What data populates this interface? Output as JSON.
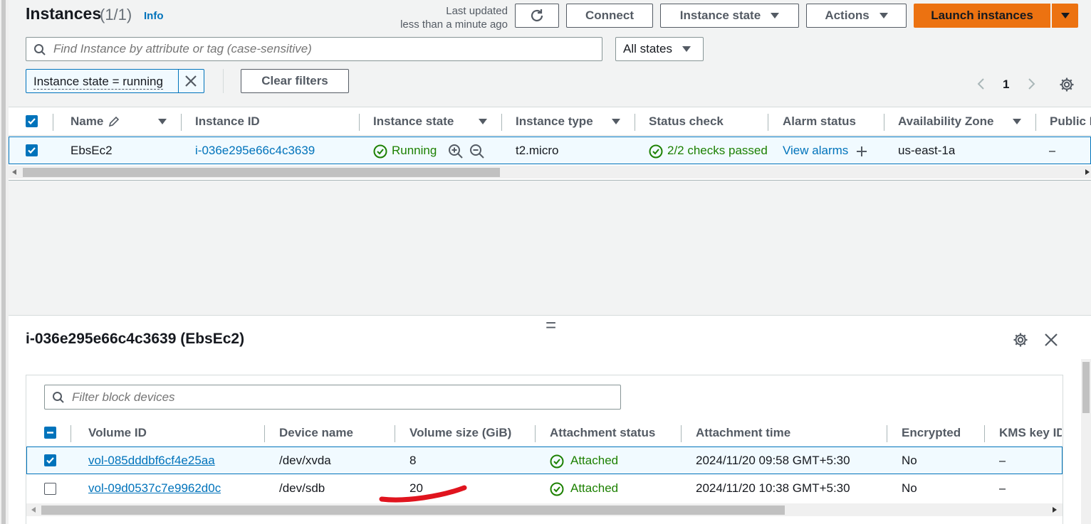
{
  "header": {
    "title": "Instances",
    "count": "(1/1)",
    "info": "Info",
    "last_updated_line1": "Last updated",
    "last_updated_line2": "less than a minute ago",
    "connect_label": "Connect",
    "instance_state_label": "Instance state",
    "actions_label": "Actions",
    "launch_label": "Launch instances"
  },
  "search": {
    "placeholder": "Find Instance by attribute or tag (case-sensitive)",
    "states_filter": "All states"
  },
  "filters": {
    "chip": "Instance state = running",
    "clear_label": "Clear filters",
    "page_number": "1"
  },
  "instances_table": {
    "columns": [
      "Name",
      "Instance ID",
      "Instance state",
      "Instance type",
      "Status check",
      "Alarm status",
      "Availability Zone",
      "Public I"
    ],
    "row": {
      "name": "EbsEc2",
      "instance_id": "i-036e295e66c4c3639",
      "state": "Running",
      "type": "t2.micro",
      "status_check": "2/2 checks passed",
      "alarm": "View alarms",
      "az": "us-east-1a",
      "public": "–"
    }
  },
  "details": {
    "splitter": "=",
    "title": "i-036e295e66c4c3639 (EbsEc2)",
    "filter_placeholder": "Filter block devices",
    "columns": [
      "Volume ID",
      "Device name",
      "Volume size (GiB)",
      "Attachment status",
      "Attachment time",
      "Encrypted",
      "KMS key ID"
    ],
    "rows": [
      {
        "volume_id": "vol-085dddbf6cf4e25aa",
        "device": "/dev/xvda",
        "size": "8",
        "status": "Attached",
        "time": "2024/11/20 09:58 GMT+5:30",
        "encrypted": "No",
        "kms": "–",
        "checked": true
      },
      {
        "volume_id": "vol-09d0537c7e9962d0c",
        "device": "/dev/sdb",
        "size": "20",
        "status": "Attached",
        "time": "2024/11/20 10:38 GMT+5:30",
        "encrypted": "No",
        "kms": "–",
        "checked": false
      }
    ]
  },
  "colors": {
    "primary": "#ec7211",
    "link": "#0073bb",
    "success": "#1d8102",
    "selected_row": "#f1faff",
    "annotation": "#e0141e"
  }
}
